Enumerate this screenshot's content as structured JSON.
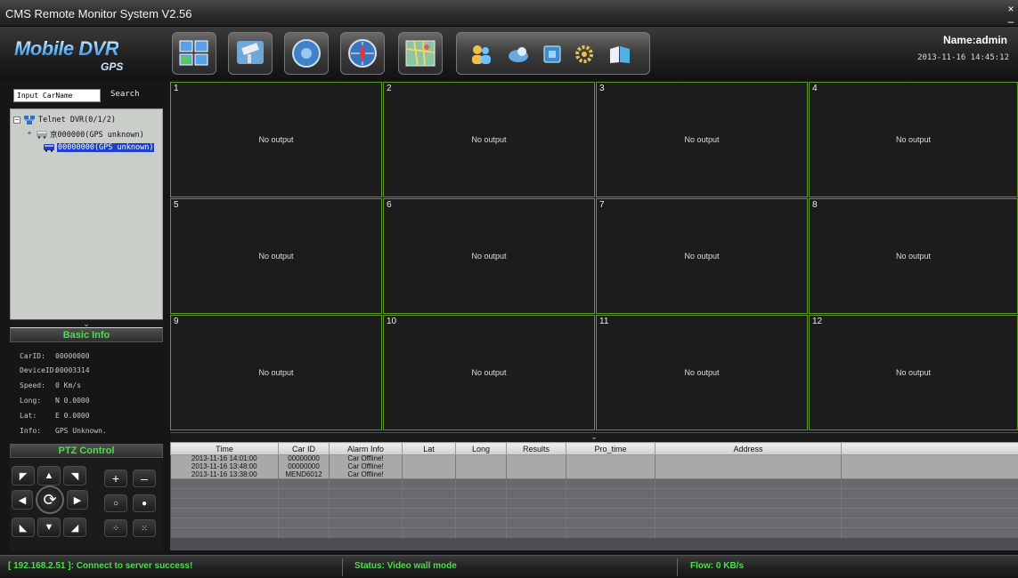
{
  "window": {
    "title": "CMS Remote Monitor System V2.56",
    "close_glyph": "×",
    "min_glyph": "–"
  },
  "logo": {
    "line1": "Mobile DVR",
    "line2": "GPS"
  },
  "toolbar": {
    "buttons": [
      "layout-grid",
      "camera",
      "playback",
      "gps-compass",
      "map"
    ],
    "group": [
      "users",
      "devices",
      "server",
      "settings",
      "help"
    ]
  },
  "user": {
    "name": "Name:admin",
    "datetime": "2013-11-16 14:45:12"
  },
  "search": {
    "value": "Input CarName",
    "button": "Search"
  },
  "tree": {
    "root": "Telnet DVR(0/1/2)",
    "children": [
      {
        "label": "京000000(GPS unknown)",
        "selected": false
      },
      {
        "label": "00000000(GPS unknown)",
        "selected": true
      }
    ]
  },
  "basic_info": {
    "title": "Basic Info",
    "rows": [
      {
        "key": "CarID:",
        "value": "00000000"
      },
      {
        "key": "DeviceID:",
        "value": "00003314"
      },
      {
        "key": "Speed:",
        "value": "0 Km/s"
      },
      {
        "key": "Long:",
        "value": "N 0.0000"
      },
      {
        "key": "Lat:",
        "value": "E 0.0000"
      },
      {
        "key": "Info:",
        "value": "GPS Unknown."
      }
    ]
  },
  "ptz": {
    "title": "PTZ Control",
    "plus": "+",
    "minus": "–"
  },
  "tiles": [
    {
      "num": "1",
      "msg": "No output"
    },
    {
      "num": "2",
      "msg": "No output"
    },
    {
      "num": "3",
      "msg": "No output"
    },
    {
      "num": "4",
      "msg": "No output"
    },
    {
      "num": "5",
      "msg": "No output"
    },
    {
      "num": "6",
      "msg": "No output"
    },
    {
      "num": "7",
      "msg": "No output"
    },
    {
      "num": "8",
      "msg": "No output"
    },
    {
      "num": "9",
      "msg": "No output"
    },
    {
      "num": "10",
      "msg": "No output"
    },
    {
      "num": "11",
      "msg": "No output"
    },
    {
      "num": "12",
      "msg": "No output"
    }
  ],
  "alarm": {
    "columns": [
      "Time",
      "Car ID",
      "Alarm Info",
      "Lat",
      "Long",
      "Results",
      "Pro_time",
      "Address",
      ""
    ],
    "rows": [
      [
        "2013-11-16 14:01:00",
        "00000000",
        "Car Offline!",
        "",
        "",
        "",
        "",
        "",
        ""
      ],
      [
        "2013-11-16 13:48:00",
        "00000000",
        "Car Offline!",
        "",
        "",
        "",
        "",
        "",
        ""
      ],
      [
        "2013-11-16 13:38:00",
        "MEND6012",
        "Car Offline!",
        "",
        "",
        "",
        "",
        "",
        ""
      ]
    ]
  },
  "status": {
    "connection": "[ 192.168.2.51 ]: Connect to server success!",
    "mode": "Status: Video wall mode",
    "flow": "Flow: 0 KB/s"
  },
  "colors": {
    "accent_green": "#4fdc4f",
    "tile_border": "#5e9a2c",
    "selection_blue": "#1e40c8"
  }
}
